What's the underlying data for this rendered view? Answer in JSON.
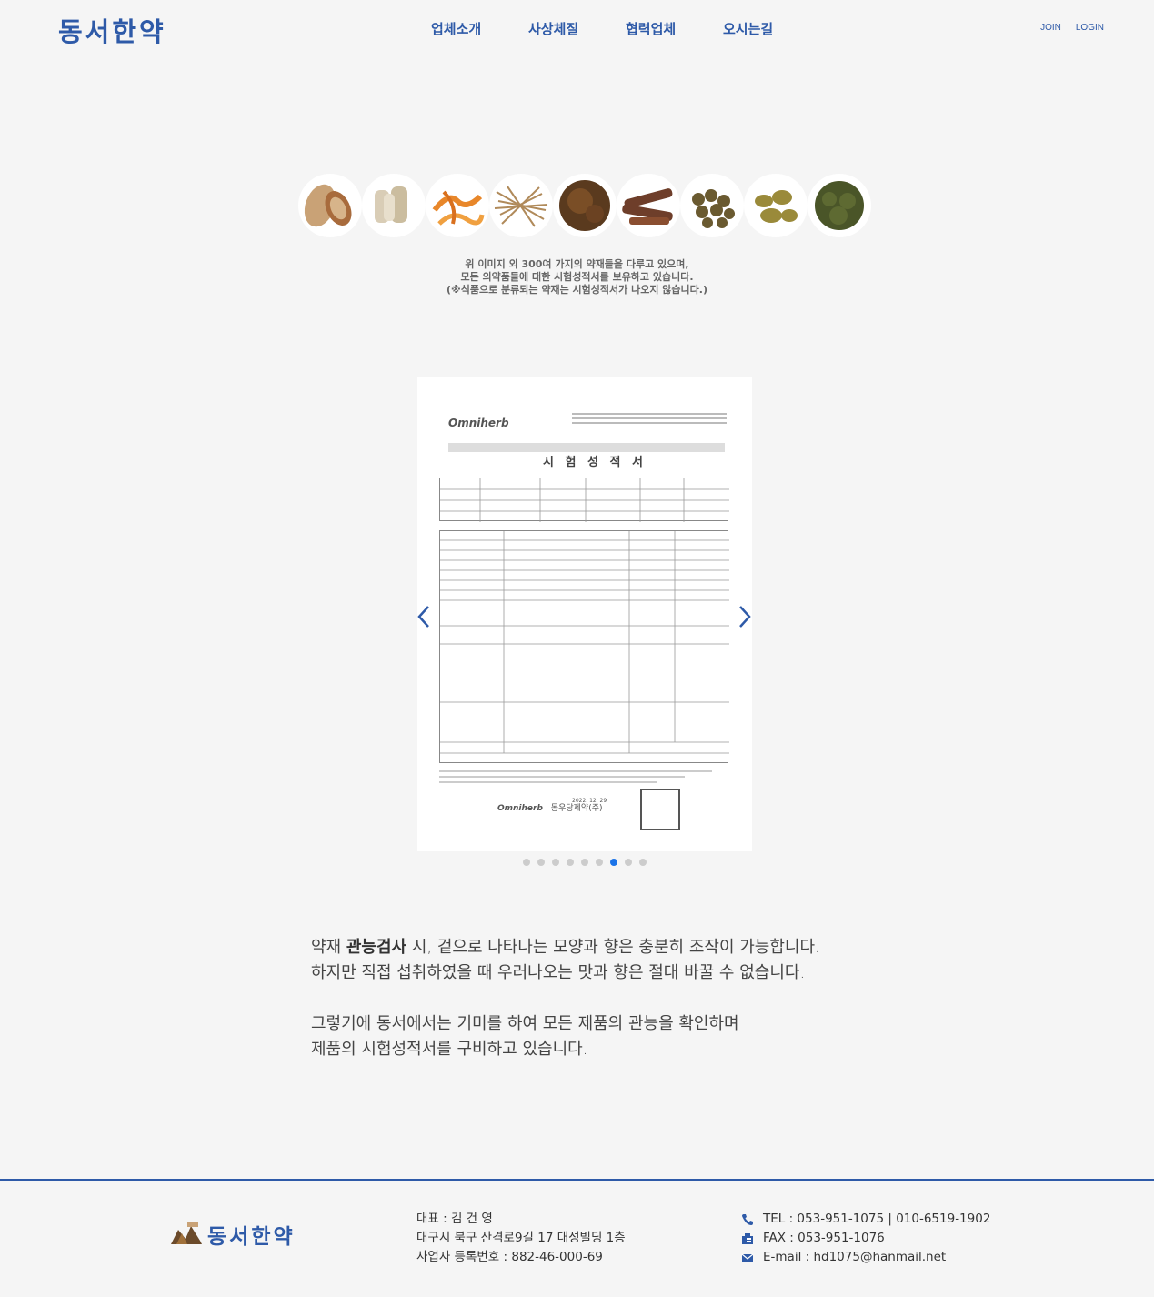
{
  "header": {
    "logo": "동서한약",
    "nav": [
      "업체소개",
      "사상체질",
      "협력업체",
      "오시는길"
    ],
    "auth": {
      "join": "JOIN",
      "login": "LOGIN"
    }
  },
  "intro": {
    "line1": "위 이미지 외 300여 가지의 약재들을 다루고 있으며,",
    "line2": "모든 의약품들에 대한 시험성적서를 보유하고 있습니다.",
    "line3": "(※식품으로 분류되는 약재는 시험성적서가 나오지 않습니다.)"
  },
  "certificate": {
    "brand": "Omniherb",
    "title": "시 험 성 적 서",
    "footer_company": "동우당제약(주)",
    "footer_date": "2022. 12. 29"
  },
  "slider": {
    "dot_count": 9,
    "active_index": 6
  },
  "description": {
    "p1_pre": "약재 ",
    "p1_bold": "관능검사",
    "p1_post": " 시, 겉으로 나타나는 모양과 향은 충분히 조작이 가능합니다.",
    "p1_line2": "하지만 직접 섭취하였을 때 우러나오는 맛과 향은 절대 바꿀 수 없습니다.",
    "p2_line1": "그렇기에 동서에서는 기미를 하여 모든 제품의 관능을 확인하며",
    "p2_line2": "제품의 시험성적서를 구비하고 있습니다."
  },
  "footer": {
    "logo": "동서한약",
    "rep": "대표 : 김 건 영",
    "address": "대구시 북구 산격로9길 17 대성빌딩 1층",
    "biz_no": "사업자 등록번호 : 882-46-000-69",
    "tel": "TEL : 053-951-1075 | 010-6519-1902",
    "fax": "FAX : 053-951-1076",
    "email": "E-mail : hd1075@hanmail.net"
  },
  "colors": {
    "brand": "#2e5aa8",
    "active_dot": "#1a73e8"
  }
}
